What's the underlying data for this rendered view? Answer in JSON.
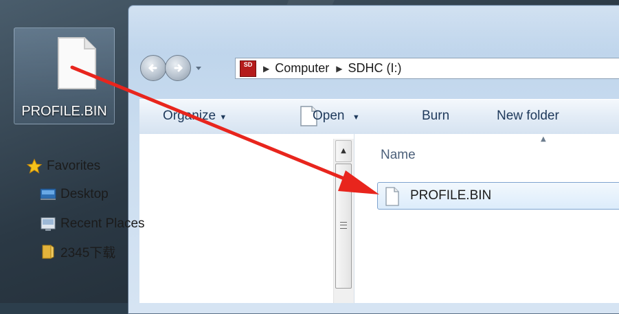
{
  "desktop": {
    "icon_label": "PROFILE.BIN",
    "icon": "blank-document-icon"
  },
  "window": {
    "address": {
      "location_icon": "sd-card-drive-icon",
      "location_icon_text": "SD",
      "crumbs": [
        "Computer",
        "SDHC (I:)"
      ]
    },
    "toolbar": {
      "organize_label": "Organize",
      "open_label": "Open",
      "burn_label": "Burn",
      "new_folder_label": "New folder"
    },
    "navigation": {
      "items": [
        {
          "label": "Favorites",
          "icon": "star-icon"
        },
        {
          "label": "Desktop",
          "icon": "desktop-icon"
        },
        {
          "label": "Recent Places",
          "icon": "recent-places-icon"
        },
        {
          "label": "2345下载",
          "icon": "folder-icon"
        }
      ]
    },
    "file_list": {
      "column_name": "Name",
      "files": [
        {
          "name": "PROFILE.BIN",
          "icon": "blank-document-icon"
        }
      ]
    }
  },
  "annotation": {
    "arrow_color": "#e8251d"
  }
}
